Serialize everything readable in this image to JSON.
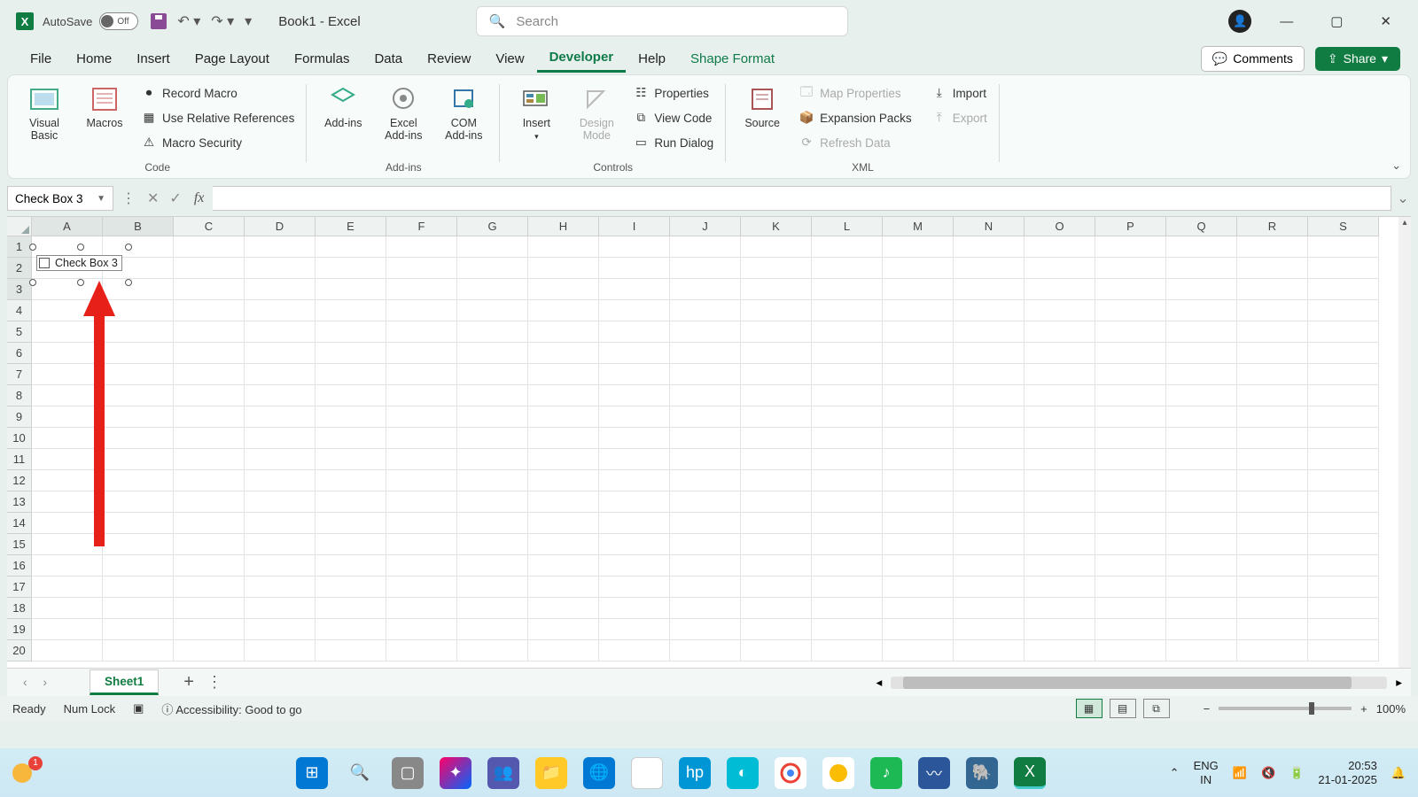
{
  "titlebar": {
    "autosave_label": "AutoSave",
    "autosave_state": "Off",
    "doc_title": "Book1  -  Excel",
    "search_placeholder": "Search"
  },
  "tabs": {
    "file": "File",
    "home": "Home",
    "insert": "Insert",
    "page_layout": "Page Layout",
    "formulas": "Formulas",
    "data": "Data",
    "review": "Review",
    "view": "View",
    "developer": "Developer",
    "help": "Help",
    "shape_format": "Shape Format",
    "comments": "Comments",
    "share": "Share"
  },
  "ribbon": {
    "code": {
      "visual_basic": "Visual Basic",
      "macros": "Macros",
      "record_macro": "Record Macro",
      "use_relative": "Use Relative References",
      "macro_security": "Macro Security",
      "label": "Code"
    },
    "addins": {
      "addins": "Add-ins",
      "excel_addins": "Excel Add-ins",
      "com_addins": "COM Add-ins",
      "label": "Add-ins"
    },
    "controls": {
      "insert": "Insert",
      "design_mode": "Design Mode",
      "properties": "Properties",
      "view_code": "View Code",
      "run_dialog": "Run Dialog",
      "label": "Controls"
    },
    "xml": {
      "source": "Source",
      "map_properties": "Map Properties",
      "expansion_packs": "Expansion Packs",
      "refresh_data": "Refresh Data",
      "import": "Import",
      "export": "Export",
      "label": "XML"
    }
  },
  "namebox": "Check Box 3",
  "checkbox_text": "Check Box 3",
  "columns": [
    "A",
    "B",
    "C",
    "D",
    "E",
    "F",
    "G",
    "H",
    "I",
    "J",
    "K",
    "L",
    "M",
    "N",
    "O",
    "P",
    "Q",
    "R",
    "S"
  ],
  "rows": [
    "1",
    "2",
    "3",
    "4",
    "5",
    "6",
    "7",
    "8",
    "9",
    "10",
    "11",
    "12",
    "13",
    "14",
    "15",
    "16",
    "17",
    "18",
    "19",
    "20"
  ],
  "sheet": {
    "name": "Sheet1"
  },
  "status": {
    "ready": "Ready",
    "numlock": "Num Lock",
    "accessibility": "Accessibility: Good to go",
    "zoom": "100%"
  },
  "tray": {
    "lang1": "ENG",
    "lang2": "IN",
    "time": "20:53",
    "date": "21-01-2025",
    "weather_count": "1"
  }
}
